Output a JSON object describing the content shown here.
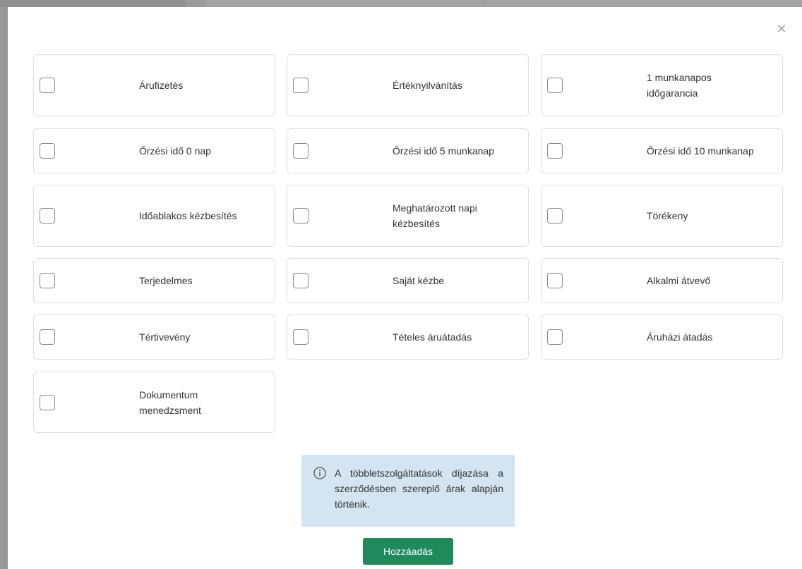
{
  "modal": {
    "close_glyph": "×",
    "options": [
      {
        "label": "Árufizetés"
      },
      {
        "label": "Értéknyilvánítás"
      },
      {
        "label": "1 munkanapos időgarancia"
      },
      {
        "label": "Őrzési idő 0 nap"
      },
      {
        "label": "Őrzési idő 5 munkanap"
      },
      {
        "label": "Őrzési idő 10 munkanap"
      },
      {
        "label": "Időablakos kézbesítés"
      },
      {
        "label": "Meghatározott napi kézbesítés"
      },
      {
        "label": "Törékeny"
      },
      {
        "label": "Terjedelmes"
      },
      {
        "label": "Saját kézbe"
      },
      {
        "label": "Alkalmi átvevő"
      },
      {
        "label": "Tértivevény"
      },
      {
        "label": "Tételes áruátadás"
      },
      {
        "label": "Áruházi átadás"
      },
      {
        "label": "Dokumentum menedzsment"
      }
    ],
    "info_text": "A többletszolgáltatások díjazása a szerződésben szereplő árak alapján történik.",
    "info_icon": "info-circle-icon",
    "add_button_label": "Hozzáadás"
  },
  "colors": {
    "accent": "#1f8a5c",
    "info_bg": "#d3e4f2",
    "border": "#dedede"
  }
}
